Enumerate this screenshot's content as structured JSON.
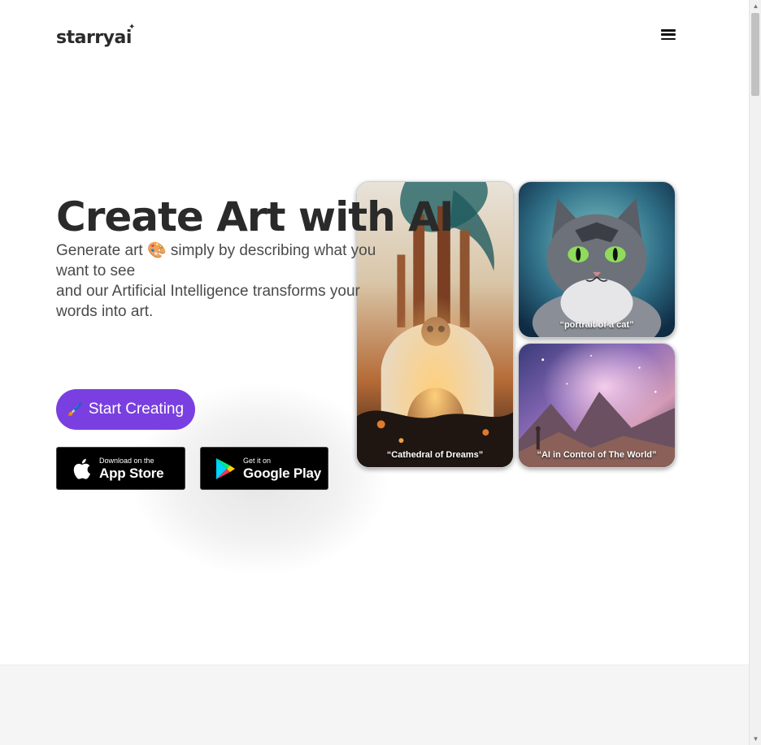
{
  "header": {
    "logo": "starryai",
    "logo_spark": "✦",
    "menu_icon": "hamburger-menu-icon"
  },
  "hero": {
    "title": "Create Art with AI",
    "subtitle_lines": [
      "Generate art 🎨 simply by describing what you",
      "want to see",
      "and our Artificial Intelligence transforms your",
      "words into art."
    ],
    "cta_icon": "🖌️",
    "cta_label": "Start Creating"
  },
  "stores": {
    "apple": {
      "small": "Download on the",
      "big": "App Store",
      "icon": "apple-logo-icon"
    },
    "google": {
      "small": "Get it on",
      "big": "Google Play",
      "icon": "google-play-logo-icon"
    }
  },
  "gallery": [
    {
      "caption": "“Cathedral of Dreams”"
    },
    {
      "caption": "“portrait of a cat”"
    },
    {
      "caption": "“AI in Control of The World”"
    }
  ],
  "colors": {
    "cta_bg": "#7a3fe0",
    "title": "#2a2a2a",
    "band_bg": "#f5f5f6"
  }
}
